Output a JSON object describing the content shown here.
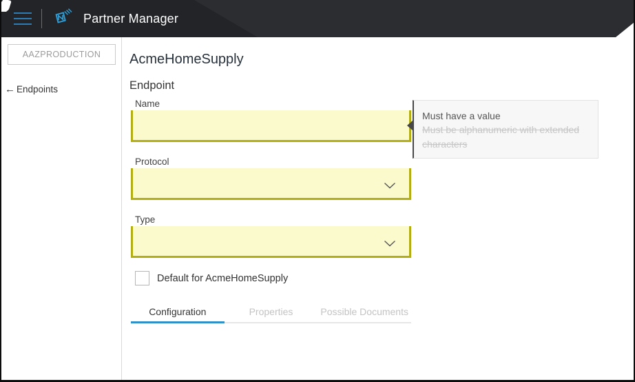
{
  "header": {
    "title": "Partner Manager"
  },
  "sidebar": {
    "environment_button_label": "AAZPRODUCTION",
    "back_link": {
      "arrow": "←",
      "label": "Endpoints"
    }
  },
  "main": {
    "page_title": "AcmeHomeSupply",
    "section_title": "Endpoint",
    "fields": {
      "name": {
        "label": "Name",
        "value": ""
      },
      "protocol": {
        "label": "Protocol",
        "value": ""
      },
      "type": {
        "label": "Type",
        "value": ""
      }
    },
    "checkbox": {
      "label": "Default for AcmeHomeSupply",
      "checked": false
    },
    "tabs": [
      {
        "label": "Configuration",
        "active": true
      },
      {
        "label": "Properties",
        "active": false
      },
      {
        "label": "Possible Documents",
        "active": false
      }
    ],
    "validation_tooltip": {
      "messages": [
        {
          "text": "Must have a value",
          "struck": false
        },
        {
          "text": "Must be alphanumeric with extended characters",
          "struck": true
        }
      ]
    }
  },
  "colors": {
    "header_bg": "#2b2d30",
    "header_bg_dark": "#222427",
    "accent_blue": "#2e91c8",
    "logo_blue": "#2e9fd8",
    "required_field_bg": "#fafacd",
    "required_field_border": "#b3ae13"
  }
}
